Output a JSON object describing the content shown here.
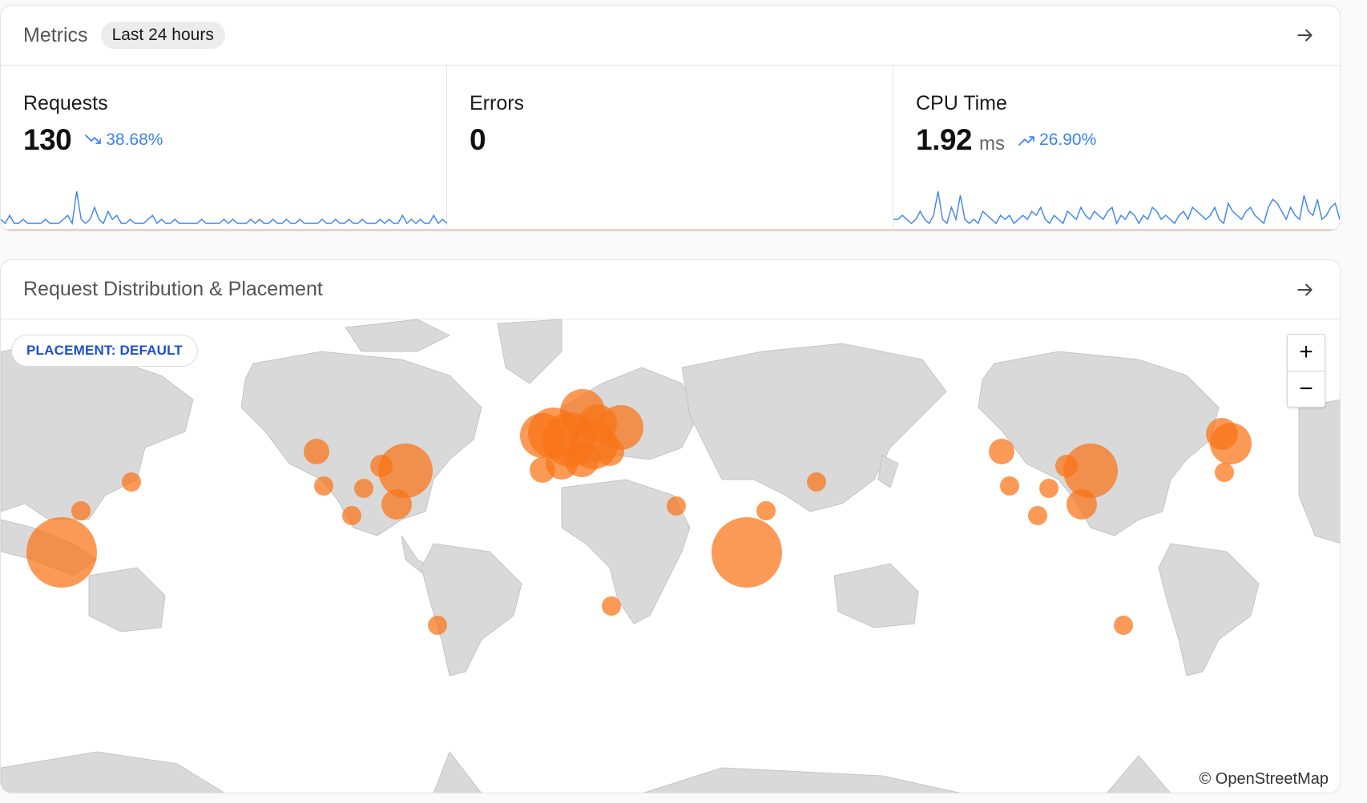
{
  "metrics": {
    "title": "Metrics",
    "range_badge": "Last 24 hours",
    "cards": [
      {
        "label": "Requests",
        "value": "130",
        "unit": "",
        "trend": "38.68%",
        "trend_dir": "down",
        "spark": [
          2,
          1,
          3,
          1,
          1,
          2,
          1,
          1,
          1,
          1,
          2,
          1,
          1,
          1,
          2,
          3,
          1,
          9,
          2,
          1,
          2,
          5,
          2,
          1,
          4,
          2,
          3,
          1,
          1,
          2,
          1,
          1,
          1,
          2,
          3,
          1,
          2,
          1,
          1,
          2,
          1,
          1,
          1,
          1,
          1,
          2,
          1,
          1,
          1,
          1,
          2,
          1,
          2,
          1,
          1,
          1,
          2,
          1,
          2,
          1,
          1,
          2,
          1,
          1,
          2,
          1,
          1,
          2,
          1,
          1,
          1,
          1,
          2,
          1,
          1,
          2,
          1,
          1,
          2,
          1,
          1,
          2,
          1,
          1,
          1,
          2,
          1,
          2,
          1,
          1,
          3,
          1,
          2,
          1,
          2,
          1,
          1,
          3,
          1,
          2,
          1
        ]
      },
      {
        "label": "Errors",
        "value": "0",
        "unit": "",
        "trend": "",
        "trend_dir": "",
        "spark": []
      },
      {
        "label": "CPU Time",
        "value": "1.92",
        "unit": "ms",
        "trend": "26.90%",
        "trend_dir": "up",
        "spark": [
          2,
          2,
          3,
          2,
          1,
          2,
          4,
          2,
          1,
          3,
          9,
          2,
          1,
          5,
          2,
          8,
          2,
          1,
          2,
          1,
          4,
          3,
          2,
          1,
          3,
          2,
          3,
          1,
          2,
          3,
          2,
          4,
          3,
          5,
          2,
          1,
          3,
          2,
          1,
          4,
          3,
          2,
          5,
          3,
          2,
          4,
          3,
          2,
          4,
          5,
          1,
          3,
          2,
          4,
          3,
          1,
          3,
          2,
          5,
          4,
          2,
          3,
          2,
          1,
          3,
          4,
          2,
          5,
          4,
          3,
          2,
          3,
          5,
          2,
          1,
          6,
          4,
          3,
          2,
          4,
          5,
          3,
          2,
          1,
          5,
          7,
          6,
          4,
          2,
          5,
          3,
          2,
          8,
          4,
          3,
          7,
          2,
          3,
          5,
          6,
          2
        ]
      }
    ]
  },
  "map_card": {
    "title": "Request Distribution & Placement",
    "placement_label": "PLACEMENT: DEFAULT",
    "zoom_in": "+",
    "zoom_out": "−",
    "attribution": "© OpenStreetMap",
    "bubble_color": "#f97316"
  },
  "icons": {
    "header_arrow": "arrow-right-icon",
    "trend_down": "trending-down-icon",
    "trend_up": "trending-up-icon"
  },
  "colors": {
    "spark_line": "#3b82f6",
    "trend_text": "#3b82f6",
    "placement_text": "#1d4ed8",
    "land": "#d9d9d9"
  }
}
